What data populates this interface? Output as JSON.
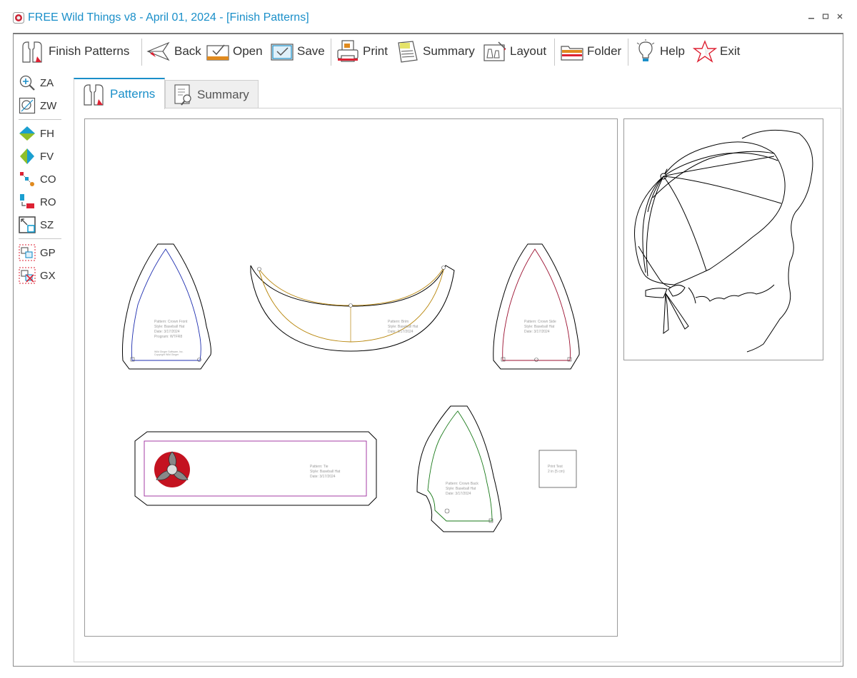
{
  "window": {
    "title": "FREE Wild Things v8 - April 01, 2024 - [Finish Patterns]",
    "minimize_icon": "minimize-icon",
    "maximize_icon": "maximize-icon",
    "close_icon": "close-icon"
  },
  "toolbar": {
    "items": [
      {
        "label": "Finish Patterns",
        "icon": "finish-patterns-icon"
      },
      {
        "label": "Back",
        "icon": "back-arrow-icon"
      },
      {
        "label": "Open",
        "icon": "open-icon"
      },
      {
        "label": "Save",
        "icon": "save-icon"
      },
      {
        "label": "Print",
        "icon": "printer-icon"
      },
      {
        "label": "Summary",
        "icon": "summary-document-icon"
      },
      {
        "label": "Layout",
        "icon": "layout-icon"
      },
      {
        "label": "Folder",
        "icon": "folder-icon"
      },
      {
        "label": "Help",
        "icon": "lightbulb-icon"
      },
      {
        "label": "Exit",
        "icon": "star-icon"
      }
    ]
  },
  "sidebar": {
    "items": [
      {
        "label": "ZA",
        "icon": "zoom-all-icon"
      },
      {
        "label": "ZW",
        "icon": "zoom-window-icon"
      },
      {
        "label": "FH",
        "icon": "flip-horizontal-icon"
      },
      {
        "label": "FV",
        "icon": "flip-vertical-icon"
      },
      {
        "label": "CO",
        "icon": "copy-icon"
      },
      {
        "label": "RO",
        "icon": "rotate-icon"
      },
      {
        "label": "SZ",
        "icon": "size-icon"
      },
      {
        "label": "GP",
        "icon": "group-icon"
      },
      {
        "label": "GX",
        "icon": "ungroup-icon"
      }
    ]
  },
  "tabs": [
    {
      "label": "Patterns",
      "active": true
    },
    {
      "label": "Summary",
      "active": false
    }
  ],
  "pieces": {
    "crown_front": [
      "Pattern: Crown Front",
      "Style: Baseball Hat",
      "Date: 3/17/2024",
      "Program: WTFR8"
    ],
    "crown_front_footer": [
      "Wild Ginger Software, Inc.",
      "Copyright Wild Ginger"
    ],
    "brim": [
      "Pattern: Brim",
      "Style: Baseball Hat",
      "Date: 3/17/2024"
    ],
    "crown_side": [
      "Pattern: Crown Side",
      "Style: Baseball Hat",
      "Date: 3/17/2024"
    ],
    "tie": [
      "Pattern: Tie",
      "Style: Baseball Hat",
      "Date: 3/17/2024"
    ],
    "crown_back": [
      "Pattern: Crown Back",
      "Style: Baseball Hat",
      "Date: 3/17/2024"
    ],
    "print_test": [
      "Print Test",
      "2 in (5 cm)"
    ]
  },
  "colors": {
    "accent": "#1a8fc9",
    "crown_front_line": "#1f2fb0",
    "brim_line": "#b8860b",
    "crown_side_line": "#9b1030",
    "tie_line": "#9b2a9b",
    "crown_back_line": "#1a7a1a"
  }
}
